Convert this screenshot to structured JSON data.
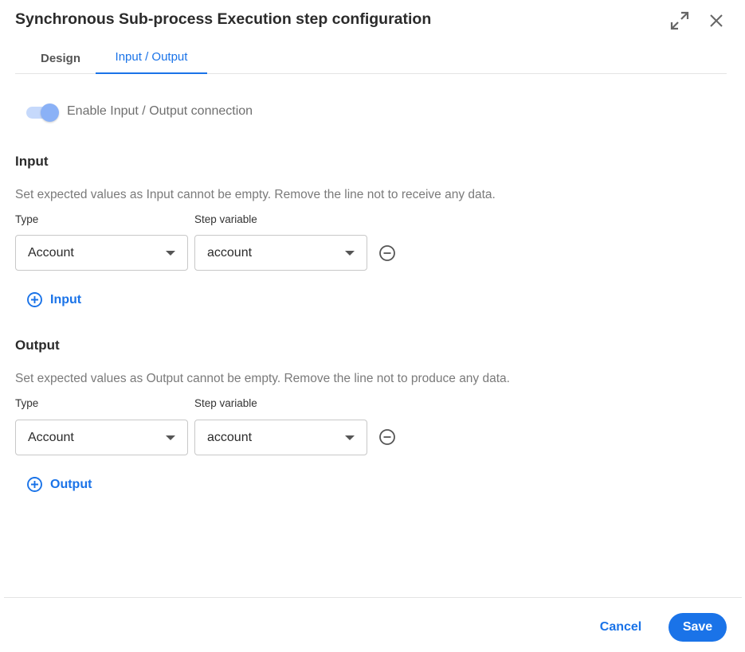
{
  "dialog": {
    "title": "Synchronous Sub-process Execution step configuration",
    "icons": {
      "expand": "expand-icon",
      "close": "close-icon"
    }
  },
  "tabs": [
    {
      "label": "Design",
      "active": false
    },
    {
      "label": "Input / Output",
      "active": true
    }
  ],
  "toggle": {
    "label": "Enable Input / Output connection",
    "enabled": true
  },
  "input": {
    "title": "Input",
    "description": "Set expected values as Input cannot be empty. Remove the line not to receive any data.",
    "type_label": "Type",
    "variable_label": "Step variable",
    "rows": [
      {
        "type": "Account",
        "variable": "account"
      }
    ],
    "add_label": "Input"
  },
  "output": {
    "title": "Output",
    "description": "Set expected values as Output cannot be empty. Remove the line not to produce any data.",
    "type_label": "Type",
    "variable_label": "Step variable",
    "rows": [
      {
        "type": "Account",
        "variable": "account"
      }
    ],
    "add_label": "Output"
  },
  "footer": {
    "cancel_label": "Cancel",
    "save_label": "Save"
  },
  "colors": {
    "accent": "#1a73e8",
    "toggle_track": "#c6d9fb",
    "toggle_knob": "#8ab1f6"
  }
}
